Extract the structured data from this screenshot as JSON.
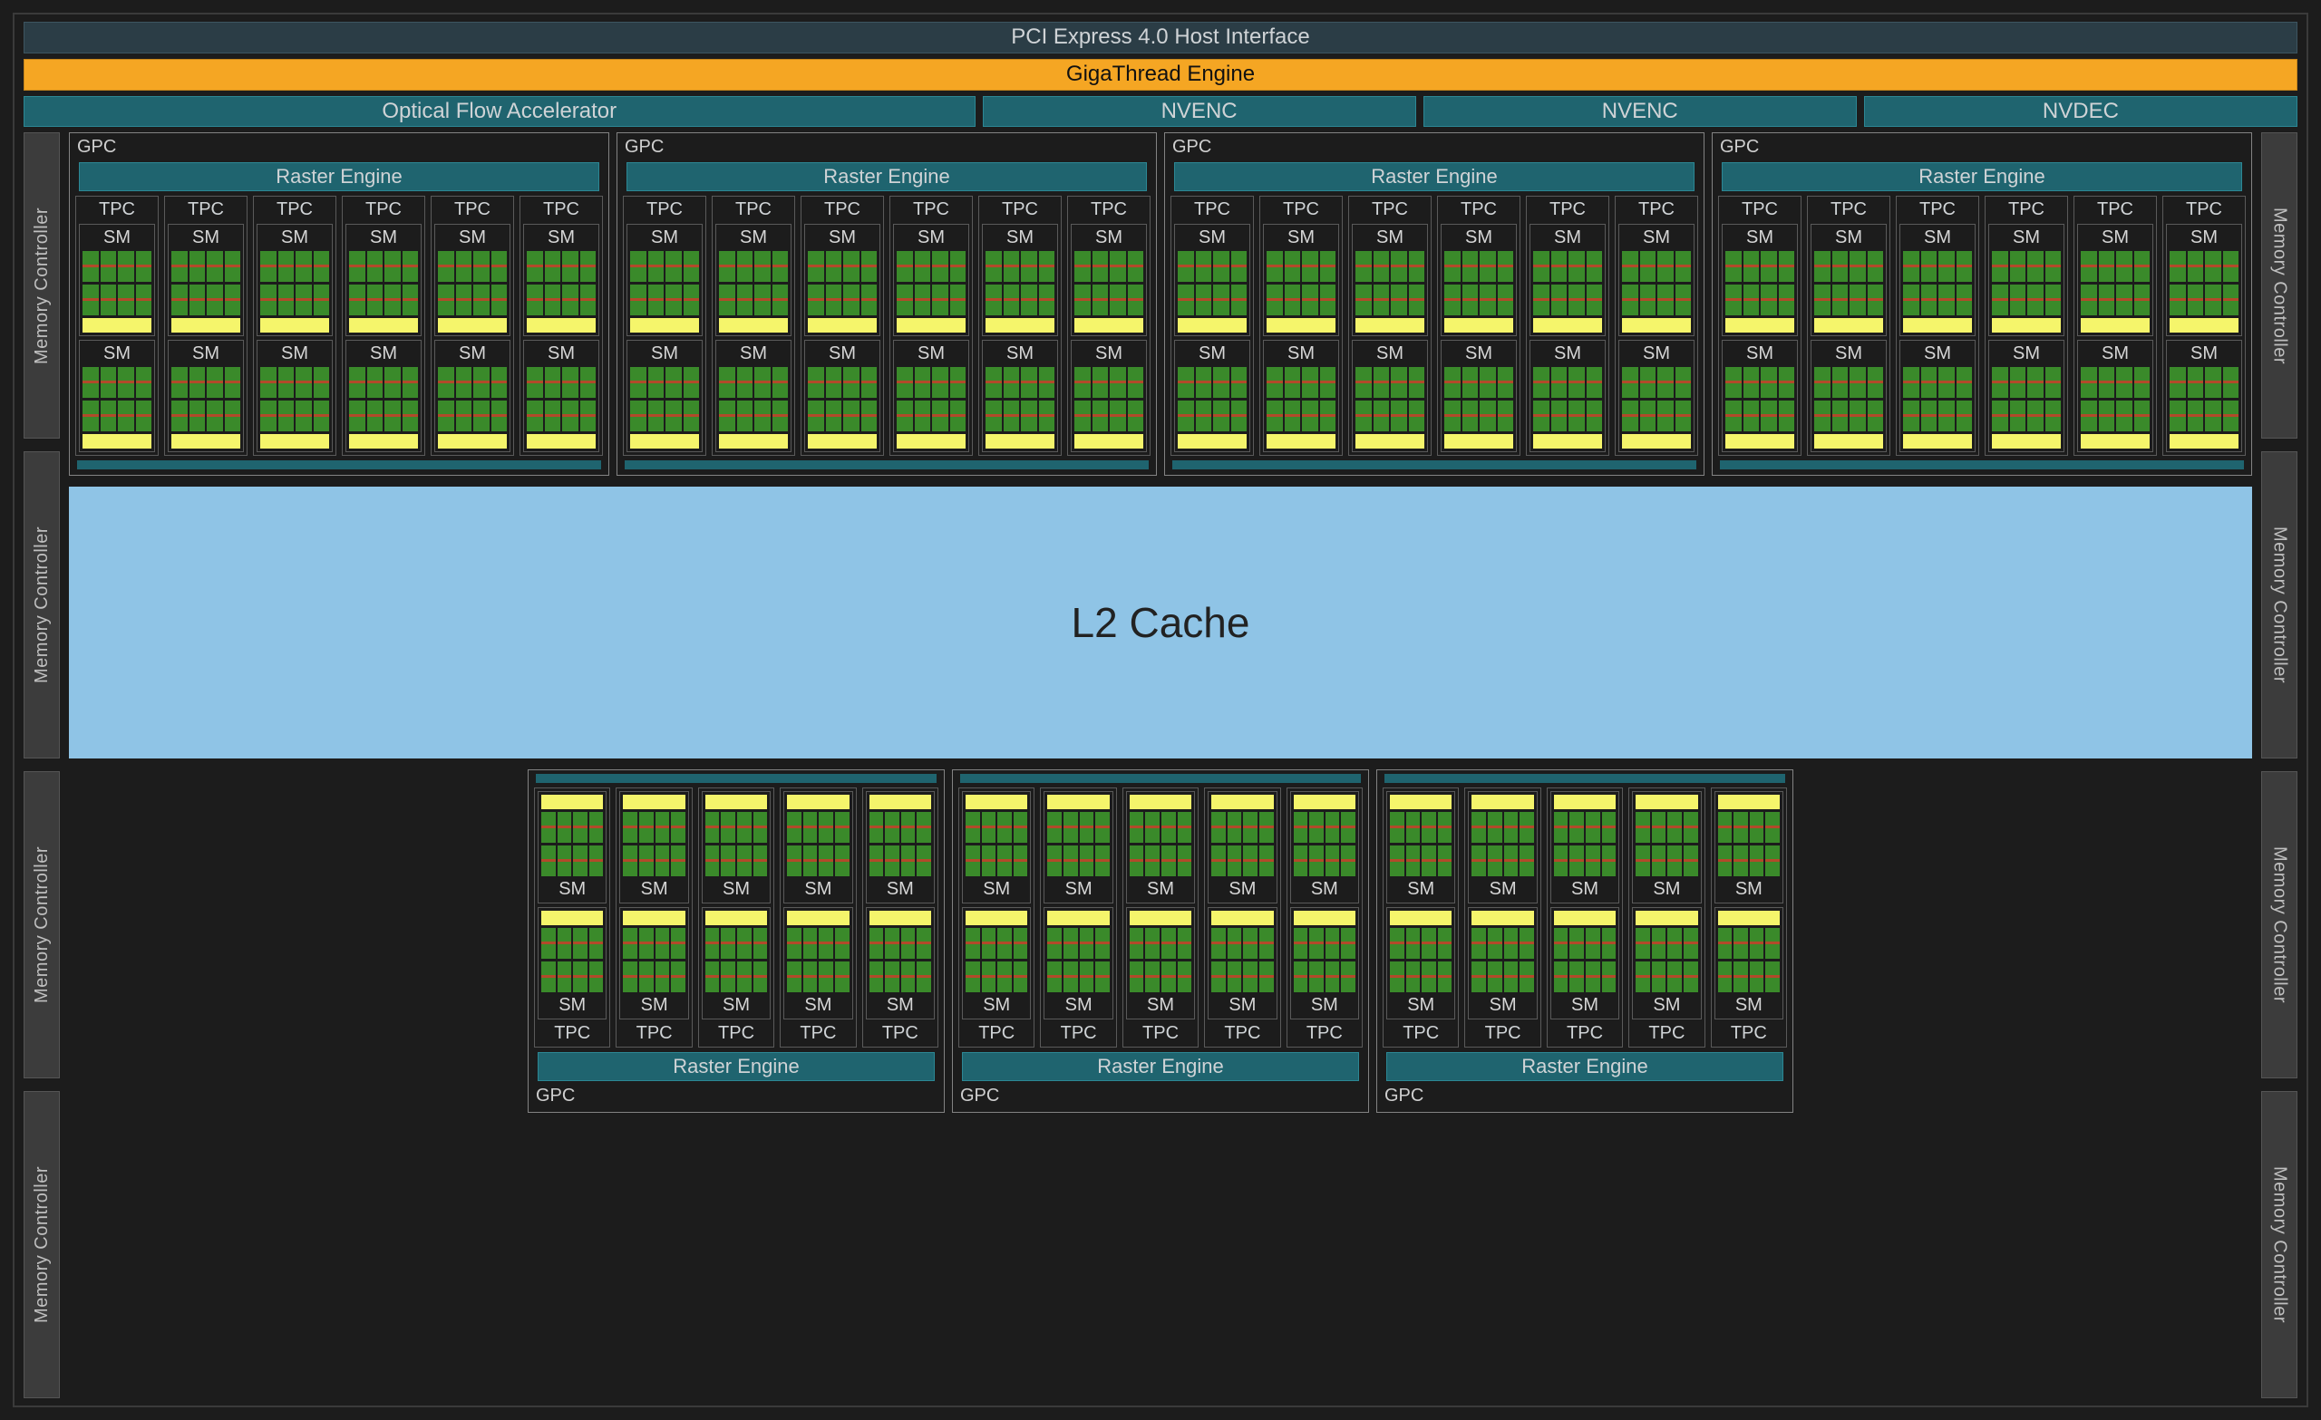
{
  "top": {
    "pci": "PCI Express 4.0 Host Interface",
    "giga": "GigaThread Engine",
    "engines": [
      "Optical Flow Accelerator",
      "NVENC",
      "NVENC",
      "NVDEC"
    ]
  },
  "memctrl_label": "Memory Controller",
  "mem_left_count": 4,
  "mem_right_count": 4,
  "l2": "L2 Cache",
  "labels": {
    "gpc": "GPC",
    "raster": "Raster Engine",
    "tpc": "TPC",
    "sm": "SM"
  },
  "layout": {
    "top_gpcs": 4,
    "top_tpcs_per_gpc": 6,
    "bottom_gpcs": 3,
    "bottom_tpcs_per_gpc": 5,
    "sms_per_tpc": 2,
    "core_columns_per_sm": 4
  }
}
